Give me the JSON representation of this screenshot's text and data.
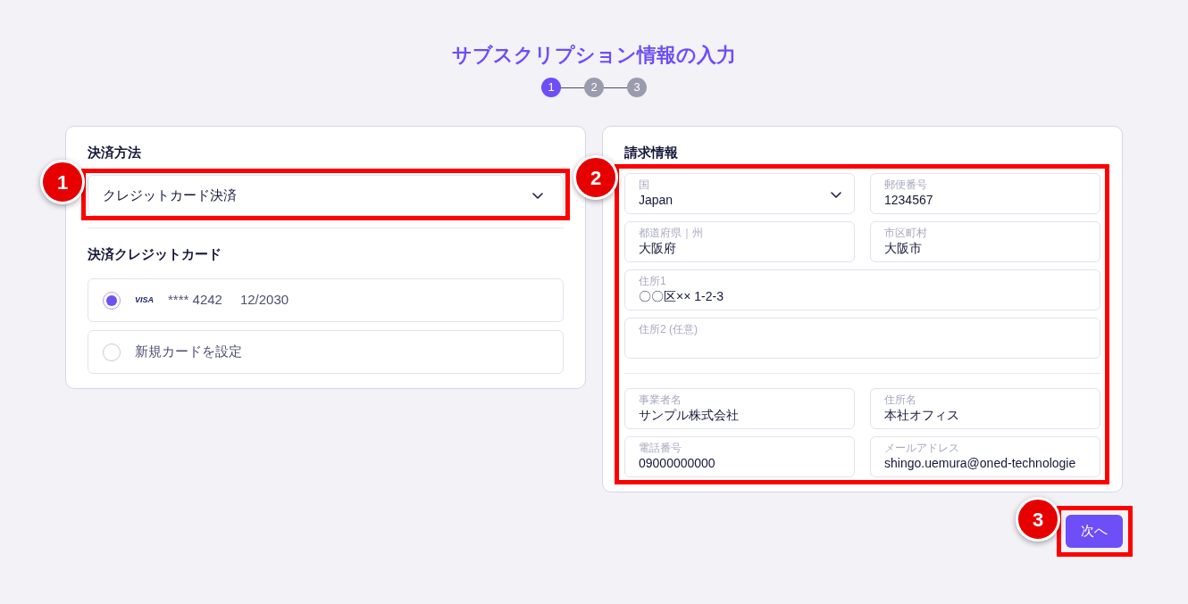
{
  "title": "サブスクリプション情報の入力",
  "steps": [
    {
      "label": "1",
      "selected": true
    },
    {
      "label": "2",
      "selected": false
    },
    {
      "label": "3",
      "selected": false
    }
  ],
  "payment": {
    "heading": "決済方法",
    "method": {
      "value": "クレジットカード決済",
      "callout": "1"
    },
    "cards_heading": "決済クレジットカード",
    "options": [
      {
        "kind": "card",
        "brand": "VISA",
        "number": "**** 4242",
        "expiry": "12/2030",
        "selected": true
      },
      {
        "kind": "new",
        "label": "新規カードを設定",
        "selected": false
      }
    ]
  },
  "billing": {
    "heading": "請求情報",
    "callout": "2",
    "groups": [
      [
        [
          {
            "kind": "select",
            "label": "国",
            "value": "Japan"
          },
          {
            "kind": "text",
            "label": "郵便番号",
            "value": "1234567"
          }
        ],
        [
          {
            "kind": "text",
            "label": "都道府県｜州",
            "value": "大阪府"
          },
          {
            "kind": "text",
            "label": "市区町村",
            "value": "大阪市"
          }
        ],
        [
          {
            "kind": "text",
            "label": "住所1",
            "value": "〇〇区×× 1-2-3"
          }
        ],
        [
          {
            "kind": "text",
            "label": "住所2 (任意)"
          }
        ]
      ],
      [
        [
          {
            "kind": "text",
            "label": "事業者名",
            "value": "サンプル株式会社"
          },
          {
            "kind": "text",
            "label": "住所名",
            "value": "本社オフィス"
          }
        ],
        [
          {
            "kind": "text",
            "label": "電話番号",
            "value": "09000000000"
          },
          {
            "kind": "text",
            "label": "メールアドレス",
            "value": "shingo.uemura@oned-technologie"
          }
        ]
      ]
    ]
  },
  "next_button": {
    "label": "次へ",
    "callout": "3"
  }
}
